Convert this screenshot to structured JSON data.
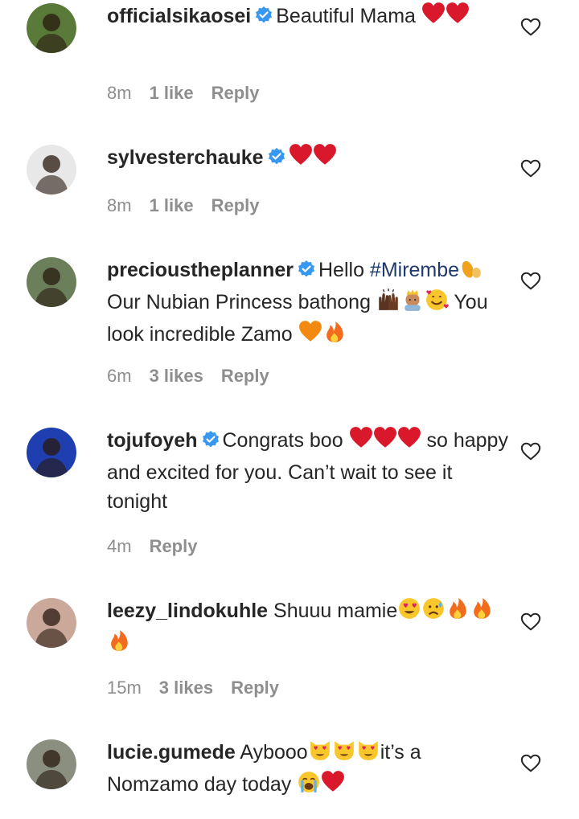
{
  "comments": [
    {
      "username": "officialsikaosei",
      "verified": true,
      "avatar_color": "#5a7a3a",
      "text_parts": [
        {
          "t": "Beautiful Mama "
        },
        {
          "e": "red-heart"
        },
        {
          "e": "red-heart"
        }
      ],
      "time": "8m",
      "likes": "1 like",
      "reply": "Reply"
    },
    {
      "username": "sylvesterchauke",
      "verified": true,
      "avatar_color": "#e8e8e8",
      "text_parts": [
        {
          "e": "red-heart"
        },
        {
          "e": "red-heart"
        }
      ],
      "time": "8m",
      "likes": "1 like",
      "reply": "Reply"
    },
    {
      "username": "precioustheplanner",
      "verified": true,
      "avatar_color": "#6b7f5a",
      "text_parts": [
        {
          "t": "Hello "
        },
        {
          "h": "#Mirembe"
        },
        {
          "e": "leaf"
        },
        {
          "t": " Our Nubian Princess bathong "
        },
        {
          "e": "raised-hands"
        },
        {
          "e": "princess"
        },
        {
          "e": "smiling-hearts"
        },
        {
          "t": " You look incredible Zamo "
        },
        {
          "e": "orange-heart"
        },
        {
          "e": "fire"
        }
      ],
      "time": "6m",
      "likes": "3 likes",
      "reply": "Reply"
    },
    {
      "username": "tojufoyeh",
      "verified": true,
      "avatar_color": "#1f3fb0",
      "text_parts": [
        {
          "t": "Congrats boo "
        },
        {
          "e": "red-heart"
        },
        {
          "e": "red-heart"
        },
        {
          "e": "red-heart"
        },
        {
          "t": " so happy and excited for you. Can’t wait to see it tonight"
        }
      ],
      "time": "4m",
      "likes": "",
      "reply": "Reply"
    },
    {
      "username": "leezy_lindokuhle",
      "verified": false,
      "avatar_color": "#caa89a",
      "text_parts": [
        {
          "t": "Shuuu mamie"
        },
        {
          "e": "heart-eyes"
        },
        {
          "e": "sad-sweat"
        },
        {
          "e": "fire"
        },
        {
          "e": "fire"
        },
        {
          "e": "fire"
        }
      ],
      "time": "15m",
      "likes": "3 likes",
      "reply": "Reply"
    },
    {
      "username": "lucie.gumede",
      "verified": false,
      "avatar_color": "#8a8f80",
      "text_parts": [
        {
          "t": "Aybooo"
        },
        {
          "e": "heart-eyes-cat"
        },
        {
          "e": "heart-eyes-cat"
        },
        {
          "e": "heart-eyes-cat"
        },
        {
          "t": "it’s a Nomzamo day today "
        },
        {
          "e": "crying"
        },
        {
          "e": "red-heart"
        }
      ],
      "time": "",
      "likes": "",
      "reply": ""
    }
  ],
  "icons": {
    "like_button": "heart-outline-icon",
    "verified": "verified-badge-icon"
  }
}
